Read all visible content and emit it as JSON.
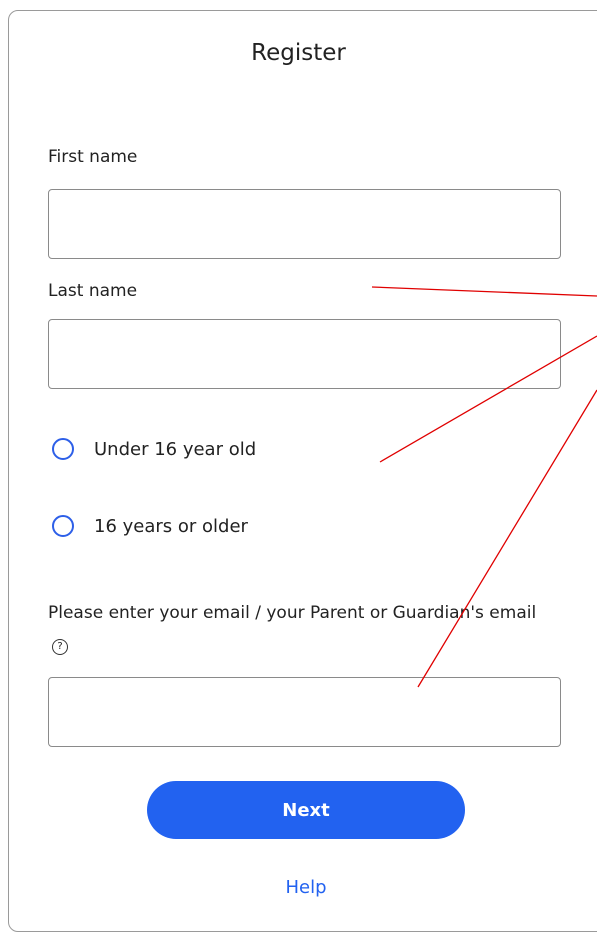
{
  "form": {
    "title": "Register",
    "first_name_label": "First name",
    "first_name_value": "",
    "last_name_label": "Last name",
    "last_name_value": "",
    "age_options": [
      {
        "label": "Under 16 year old",
        "selected": false
      },
      {
        "label": "16 years or older",
        "selected": false
      }
    ],
    "email_label": "Please enter your email / your Parent or Guardian's email",
    "email_help_glyph": "?",
    "email_value": "",
    "next_label": "Next",
    "help_label": "Help"
  },
  "colors": {
    "accent": "#2262f0",
    "annotation_line": "#e00000"
  }
}
